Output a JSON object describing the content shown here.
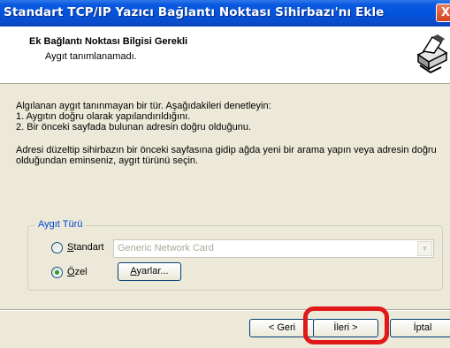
{
  "window": {
    "title": "Standart TCP/IP Yazıcı Bağlantı Noktası Sihirbazı'nı Ekle",
    "close_label": "X"
  },
  "header": {
    "title": "Ek Bağlantı Noktası Bilgisi Gerekli",
    "subtitle": "Aygıt tanımlanamadı.",
    "icon": "printer-wizard-icon"
  },
  "body": {
    "lines1": [
      "Algılanan aygıt tanınmayan bir tür.  Aşağıdakileri denetleyin:",
      "1. Aygıtın doğru olarak yapılandırıldığını.",
      "2.  Bir önceki sayfada bulunan adresin doğru olduğunu."
    ],
    "lines2": [
      "Adresi düzeltip sihirbazın bir önceki sayfasına gidip ağda yeni bir arama yapın veya adresin doğru",
      "olduğundan eminseniz, aygıt türünü seçin."
    ]
  },
  "device_type": {
    "legend": "Aygıt Türü",
    "standard_label": "Standart",
    "standard_checked": false,
    "custom_label": "Özel",
    "custom_checked": true,
    "select_value": "Generic Network Card",
    "settings_button": "Ayarlar..."
  },
  "footer": {
    "back": "< Geri",
    "next": "İleri >",
    "cancel": "İptal"
  },
  "colors": {
    "title_bar": "#0453dd",
    "highlight": "#e01818",
    "legend": "#0046d5"
  }
}
